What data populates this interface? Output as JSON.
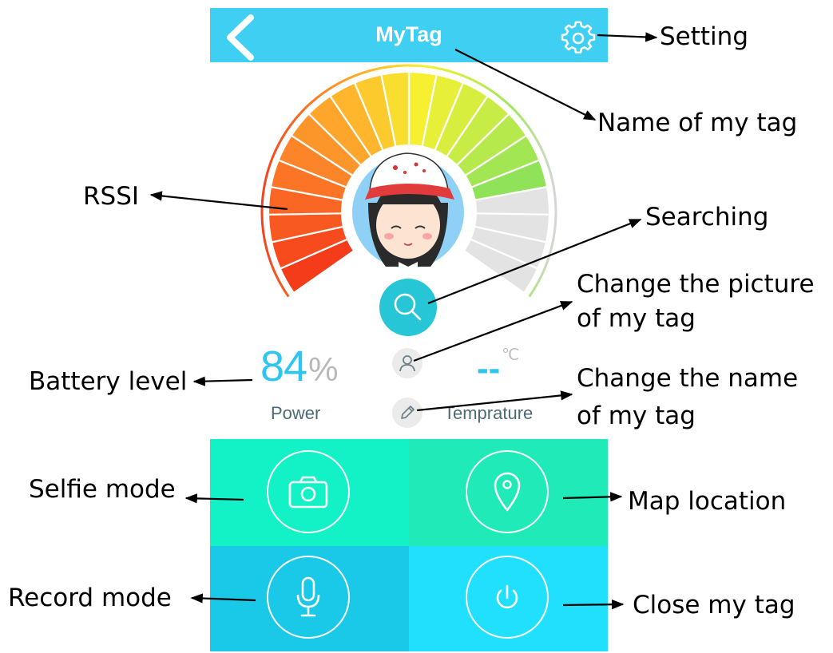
{
  "app": {
    "title": "MyTag"
  },
  "icons": {
    "back": "chevron-left-icon",
    "settings": "gear-icon",
    "search": "search-icon",
    "photo": "user-icon",
    "rename": "pencil-icon",
    "selfie": "camera-icon",
    "map": "map-pin-icon",
    "record": "microphone-icon",
    "close": "power-icon"
  },
  "stats": {
    "battery_value": "84",
    "battery_unit": "%",
    "battery_label": "Power",
    "temperature_value": "--",
    "temperature_unit": "℃",
    "temperature_label": "Temprature"
  },
  "colors": {
    "header": "#3ecff2",
    "accent": "#2ec5f1",
    "search_button": "#26c6d6",
    "tile_selfie": "#13f1c7",
    "tile_map": "#1feab8",
    "tile_record": "#1ac8e8",
    "tile_close": "#21e0fd"
  },
  "annotations": {
    "setting": "Setting",
    "tag_name": "Name of my tag",
    "rssi": "RSSI",
    "searching": "Searching",
    "change_picture_1": "Change the picture",
    "change_picture_2": "of my tag",
    "battery": "Battery level",
    "change_name_1": "Change the name",
    "change_name_2": "of my tag",
    "selfie": "Selfie mode",
    "map": "Map location",
    "record": "Record mode",
    "close": "Close my tag"
  }
}
